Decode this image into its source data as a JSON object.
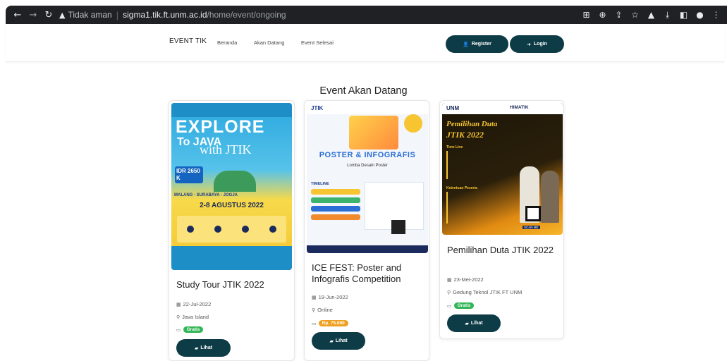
{
  "browser": {
    "security_label": "Tidak aman",
    "url_host": "sigma1.tik.ft.unm.ac.id",
    "url_path": "/home/event/ongoing"
  },
  "navbar": {
    "brand": "EVENT TIK",
    "links": [
      "Beranda",
      "Akan Datang",
      "Event Selesai"
    ],
    "register_label": "Register",
    "login_label": "Login"
  },
  "section_title": "Event Akan Datang",
  "events": [
    {
      "title": "Study Tour JTIK 2022",
      "date": "22-Jul-2022",
      "location": "Java Island",
      "price": "Gratis",
      "button": "Lihat",
      "poster": {
        "line1": "EXPLORE",
        "line2": "To JAVA",
        "line3": "with JTIK",
        "price_tag": "IDR 2650 K",
        "dates": "2-8 AGUSTUS 2022",
        "cities": "MALANG · SURABAYA · JOGJA"
      }
    },
    {
      "title": "ICE FEST: Poster and Infografis Competition",
      "date": "19-Jun-2022",
      "location": "Online",
      "price": "Rp. 75.000",
      "button": "Lihat",
      "poster": {
        "brand": "JTIK",
        "headline": "POSTER & INFOGRAFIS",
        "sub": "Lomba Desain Poster",
        "timeline": "TIMELINE"
      }
    },
    {
      "title": "Pemilihan Duta JTIK 2022",
      "date": "23-Mei-2022",
      "location": "Gedung Teknol JTIK FT UNM",
      "price": "Gratis",
      "button": "Lihat",
      "poster": {
        "brand": "UNM",
        "org": "HIMATIK",
        "headline1": "Pemilihan Duta",
        "headline2": "JTIK 2022",
        "timeline": "Time Line",
        "rules": "Ketentuan Peserta",
        "scan": "SCAN ME"
      }
    }
  ],
  "colors": {
    "primary": "#0d3b46",
    "badge_green": "#2fb655",
    "badge_orange": "#f0a020"
  }
}
